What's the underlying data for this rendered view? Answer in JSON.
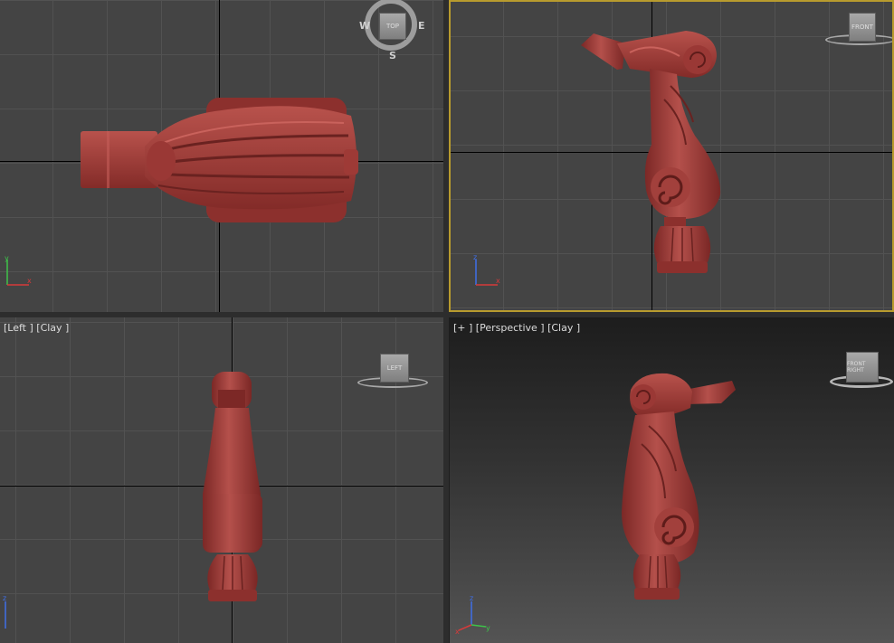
{
  "viewports": {
    "top": {
      "label": ""
    },
    "front": {
      "label": ""
    },
    "left": {
      "label": "[Left ] [Clay ]"
    },
    "perspective": {
      "label": "[+ ] [Perspective ] [Clay ]"
    }
  },
  "navcube": {
    "top": {
      "face": "TOP",
      "west": "W",
      "east": "E",
      "south": "S"
    },
    "front": {
      "face": "FRONT"
    },
    "left": {
      "face": "LEFT"
    },
    "perspective": {
      "face": "FRONT RIGHT"
    }
  },
  "colors": {
    "clay": "#a8413d",
    "clay_dark": "#5e1c1a",
    "grid_bg": "#444444",
    "active_border": "#b89b2e",
    "axis_x": "#d73a3a",
    "axis_y": "#3ec24a",
    "axis_z": "#3f6fe8"
  },
  "icons": {
    "gizmo": "xyz-axis-tripod-icon",
    "navcube": "view-cube-icon"
  }
}
